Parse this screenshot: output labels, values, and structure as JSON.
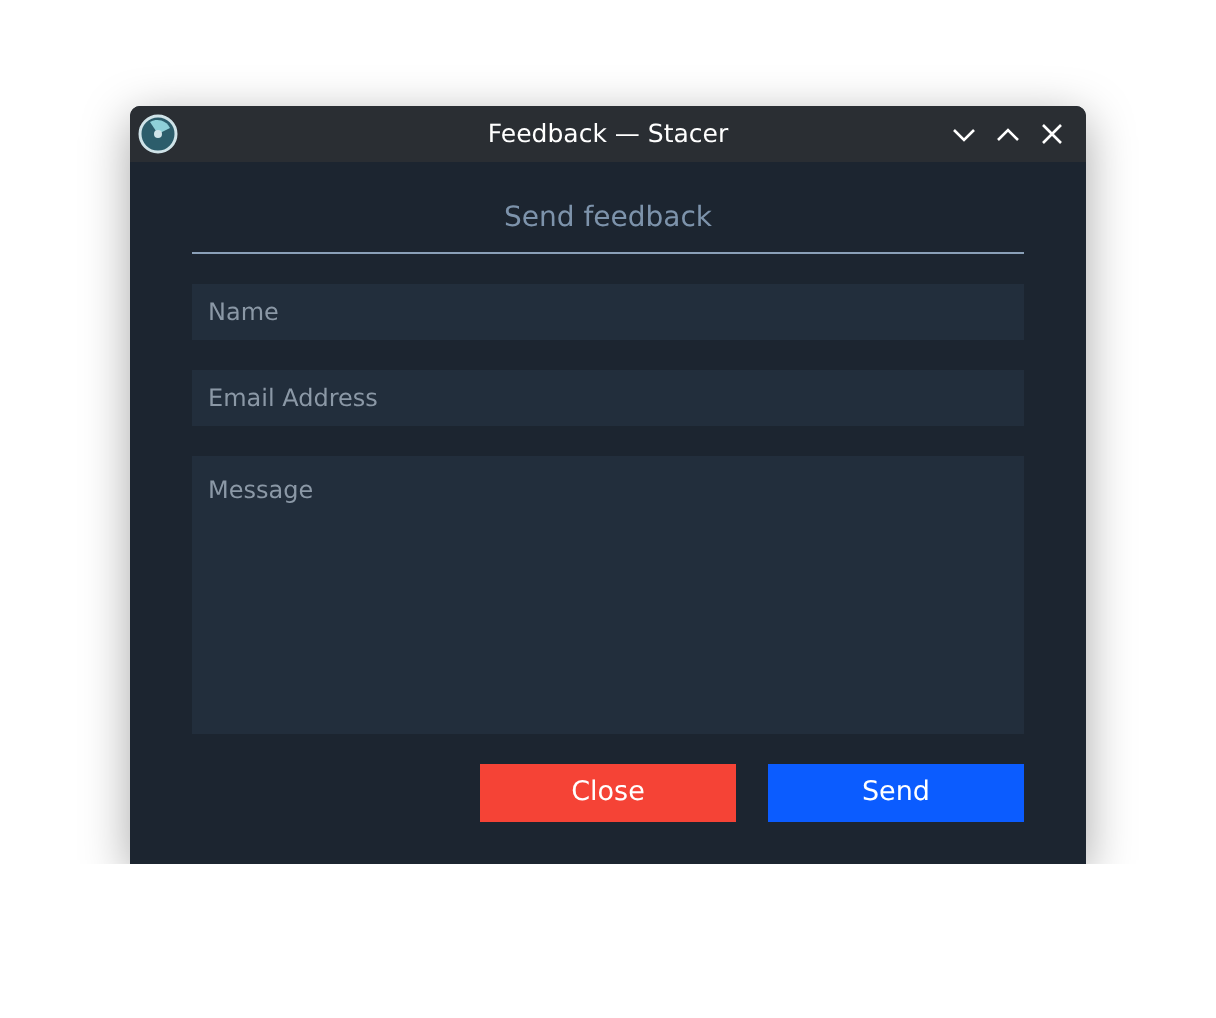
{
  "window": {
    "title": "Feedback — Stacer"
  },
  "heading": "Send feedback",
  "fields": [
    {
      "kind": "line",
      "placeholder": "Name"
    },
    {
      "kind": "line",
      "placeholder": "Email Address"
    },
    {
      "kind": "area",
      "placeholder": "Message"
    }
  ],
  "buttons": [
    {
      "kind": "close",
      "label": "Close"
    },
    {
      "kind": "send",
      "label": "Send"
    }
  ]
}
